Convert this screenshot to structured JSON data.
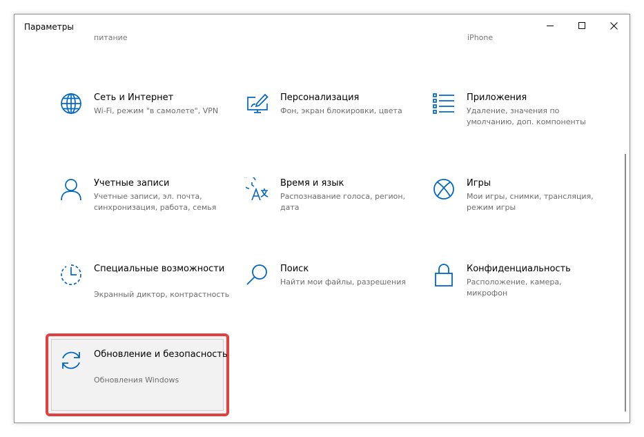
{
  "window": {
    "title": "Параметры",
    "controls": [
      "minimize",
      "maximize",
      "close"
    ]
  },
  "clipped_above": {
    "left": "питание",
    "right": "iPhone"
  },
  "tiles": [
    {
      "title": "Сеть и Интернет",
      "description": "Wi-Fi, режим \"в самолете\", VPN",
      "icon": "globe-icon"
    },
    {
      "title": "Персонализация",
      "description": "Фон, экран блокировки, цвета",
      "icon": "personalization-icon"
    },
    {
      "title": "Приложения",
      "description": "Удаление, значения по умолчанию, доп. компоненты",
      "icon": "apps-list-icon"
    },
    {
      "title": "Учетные записи",
      "description": "Учетные записи, эл. почта, синхронизация, работа, семья",
      "icon": "person-icon"
    },
    {
      "title": "Время и язык",
      "description": "Распознавание голоса, регион, дата",
      "icon": "time-language-icon"
    },
    {
      "title": "Игры",
      "description": "Мои игры, снимки, трансляция, режим игры",
      "icon": "xbox-icon"
    },
    {
      "title": "Специальные возможности",
      "description": "Экранный диктор, контрастность",
      "icon": "ease-of-access-icon"
    },
    {
      "title": "Поиск",
      "description": "Найти мои файлы, разрешения",
      "icon": "search-icon"
    },
    {
      "title": "Конфиденциальность",
      "description": "Расположение, камера, микрофон",
      "icon": "lock-icon"
    },
    {
      "title": "Обновление и безопасность",
      "description": "Обновления Windows",
      "icon": "sync-icon",
      "highlighted": true
    }
  ],
  "colors": {
    "accent": "#0067c0",
    "highlight_border": "#e0403f"
  }
}
